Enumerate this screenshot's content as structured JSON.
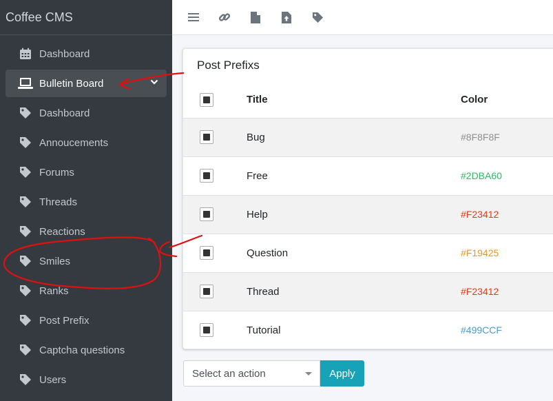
{
  "sidebar": {
    "brand": "Coffee CMS",
    "items": [
      {
        "label": "Dashboard",
        "icon": "calendar-icon"
      },
      {
        "label": "Bulletin Board",
        "icon": "laptop-icon",
        "active": true
      },
      {
        "label": "Dashboard",
        "icon": "tag-icon"
      },
      {
        "label": "Annoucements",
        "icon": "tag-icon"
      },
      {
        "label": "Forums",
        "icon": "tag-icon"
      },
      {
        "label": "Threads",
        "icon": "tag-icon"
      },
      {
        "label": "Reactions",
        "icon": "tag-icon"
      },
      {
        "label": "Smiles",
        "icon": "tag-icon"
      },
      {
        "label": "Ranks",
        "icon": "tag-icon"
      },
      {
        "label": "Post Prefix",
        "icon": "tag-icon"
      },
      {
        "label": "Captcha questions",
        "icon": "tag-icon"
      },
      {
        "label": "Users",
        "icon": "tag-icon"
      }
    ]
  },
  "topbar": {
    "icons": [
      "menu-icon",
      "link-icon",
      "file-icon",
      "file-upload-icon",
      "tag-icon"
    ]
  },
  "card": {
    "title": "Post Prefixs",
    "columns": {
      "title": "Title",
      "color": "Color"
    },
    "rows": [
      {
        "title": "Bug",
        "color": "#8F8F8F"
      },
      {
        "title": "Free",
        "color": "#2DBA60"
      },
      {
        "title": "Help",
        "color": "#F23412"
      },
      {
        "title": "Question",
        "color": "#F19425"
      },
      {
        "title": "Thread",
        "color": "#F23412"
      },
      {
        "title": "Tutorial",
        "color": "#499CCF"
      }
    ]
  },
  "actions": {
    "select_value": "Select an action",
    "apply_label": "Apply"
  },
  "colors": {
    "sidebar_bg": "#343a40",
    "active_item_bg": "#494e53",
    "apply_bg": "#17a2b8",
    "annotation": "#e01010"
  }
}
